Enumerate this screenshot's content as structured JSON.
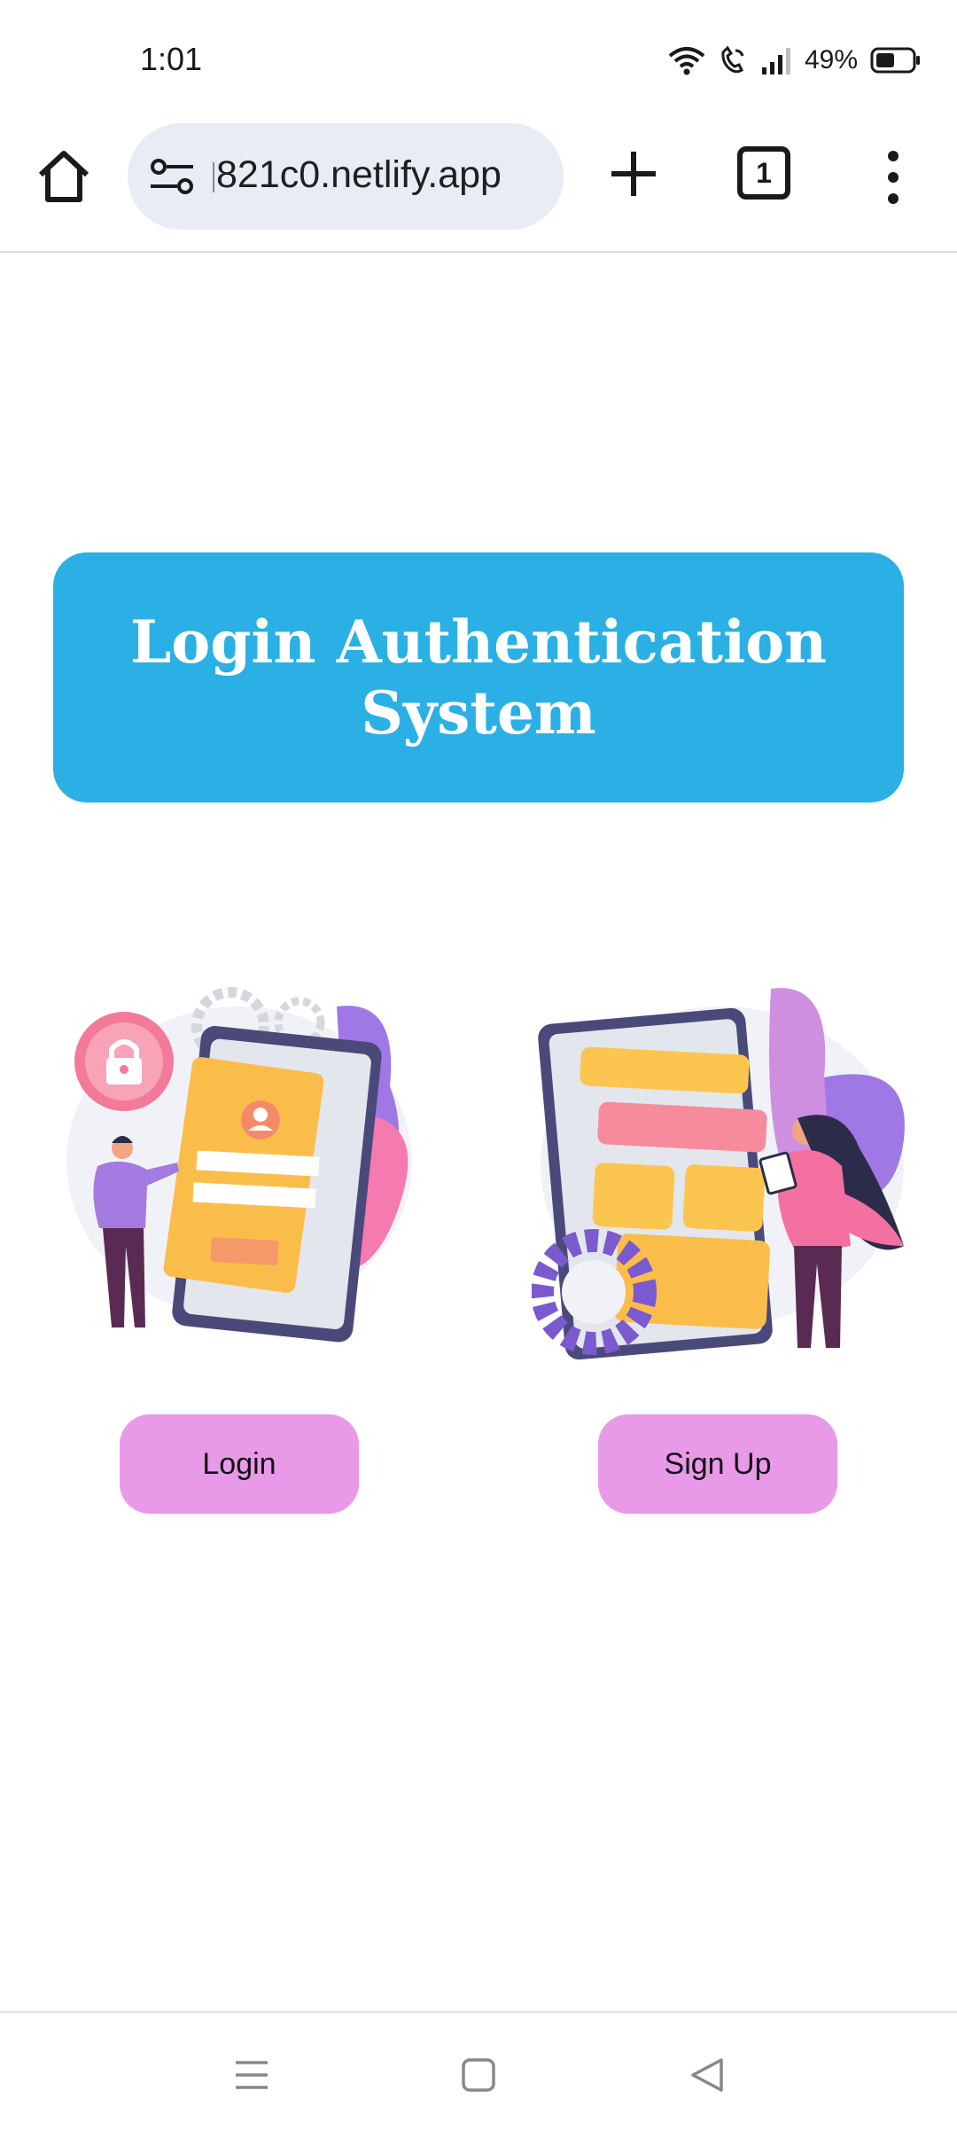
{
  "status_bar": {
    "time": "1:01",
    "battery_percent": "49%",
    "icons": [
      "wifi-icon",
      "wifi-calling-icon",
      "signal-icon",
      "battery-icon"
    ]
  },
  "browser": {
    "url": "821c0.netlify.app",
    "tab_count": "1",
    "icons": [
      "home-icon",
      "site-settings-icon",
      "new-tab-icon",
      "tab-switcher-icon",
      "more-menu-icon"
    ]
  },
  "page": {
    "title": "Login Authentication System",
    "banner_color": "#2ab0e4",
    "button_color": "#e899e8",
    "buttons": {
      "login": "Login",
      "signup": "Sign Up"
    }
  },
  "nav_bar": {
    "icons": [
      "recents-icon",
      "home-nav-icon",
      "back-icon"
    ]
  }
}
